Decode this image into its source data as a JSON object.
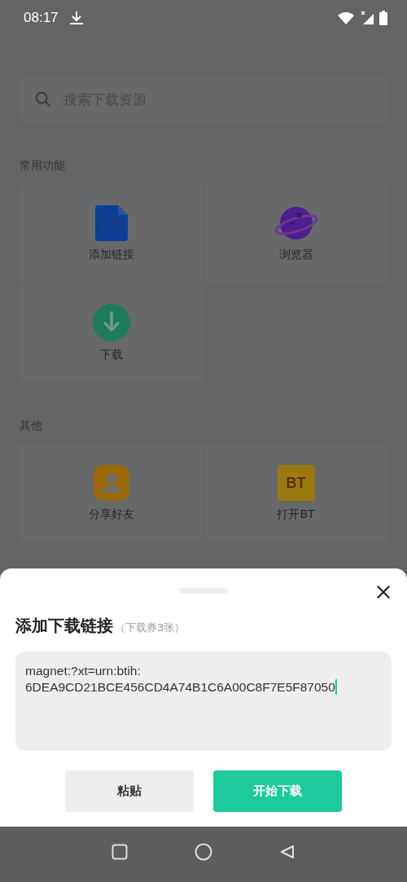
{
  "status_bar": {
    "time": "08:17"
  },
  "search": {
    "placeholder": "搜索下载资源"
  },
  "sections": [
    {
      "title": "常用功能",
      "tiles": [
        {
          "label": "添加链接",
          "kind": "link"
        },
        {
          "label": "浏览器",
          "kind": "planet"
        },
        {
          "label": "下载",
          "kind": "download"
        }
      ]
    },
    {
      "title": "其他",
      "tiles": [
        {
          "label": "分享好友",
          "kind": "person"
        },
        {
          "label": "打开BT",
          "kind": "folder",
          "badge": "BT"
        }
      ]
    }
  ],
  "sheet": {
    "title": "添加下载链接",
    "subtitle": "（下载券3张）",
    "field_lines": [
      "magnet:?xt=urn:btih:",
      "6DEA9CD21BCE456CD4A74B1C6A00C8F7E5F87050"
    ],
    "buttons": [
      {
        "label": "粘贴",
        "kind": "secondary"
      },
      {
        "label": "开始下载",
        "kind": "primary"
      }
    ]
  }
}
